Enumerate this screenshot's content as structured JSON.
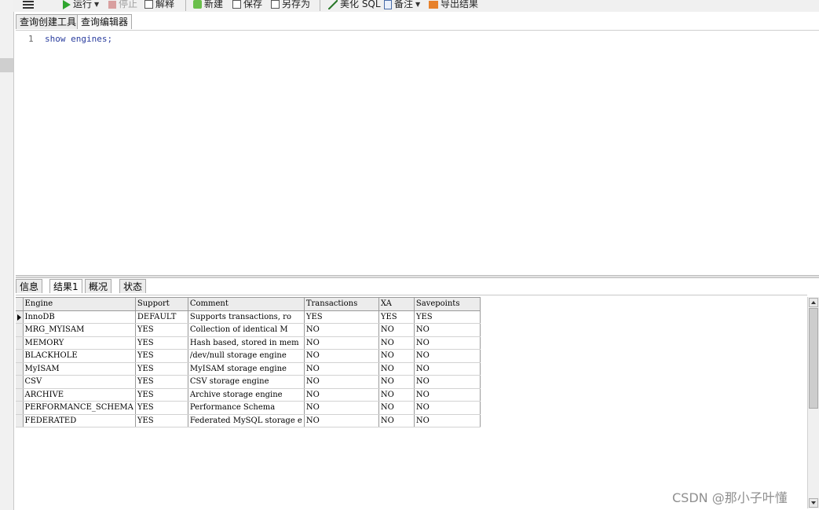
{
  "toolbar": {
    "run_label": "运行",
    "stop_label": "停止",
    "explain_label": "解释",
    "new_label": "新建",
    "save_label": "保存",
    "save_as_label": "另存为",
    "beautify_label": "美化 SQL",
    "note_label": "备注",
    "export_label": "导出结果"
  },
  "query_tabs": [
    "查询创建工具",
    "查询编辑器"
  ],
  "editor": {
    "line_number": "1",
    "code": "show engines;"
  },
  "result_tabs": [
    "信息",
    "结果1",
    "概况",
    "状态"
  ],
  "grid": {
    "columns": [
      "Engine",
      "Support",
      "Comment",
      "Transactions",
      "XA",
      "Savepoints"
    ],
    "rows": [
      [
        "InnoDB",
        "DEFAULT",
        "Supports transactions, ro",
        "YES",
        "YES",
        "YES"
      ],
      [
        "MRG_MYISAM",
        "YES",
        "Collection of identical M",
        "NO",
        "NO",
        "NO"
      ],
      [
        "MEMORY",
        "YES",
        "Hash based, stored in mem",
        "NO",
        "NO",
        "NO"
      ],
      [
        "BLACKHOLE",
        "YES",
        "/dev/null storage engine",
        "NO",
        "NO",
        "NO"
      ],
      [
        "MyISAM",
        "YES",
        "MyISAM storage engine",
        "NO",
        "NO",
        "NO"
      ],
      [
        "CSV",
        "YES",
        "CSV storage engine",
        "NO",
        "NO",
        "NO"
      ],
      [
        "ARCHIVE",
        "YES",
        "Archive storage engine",
        "NO",
        "NO",
        "NO"
      ],
      [
        "PERFORMANCE_SCHEMA",
        "YES",
        "Performance Schema",
        "NO",
        "NO",
        "NO"
      ],
      [
        "FEDERATED",
        "YES",
        "Federated MySQL storage e",
        "NO",
        "NO",
        "NO"
      ]
    ]
  },
  "watermark": "CSDN @那小子叶懂"
}
